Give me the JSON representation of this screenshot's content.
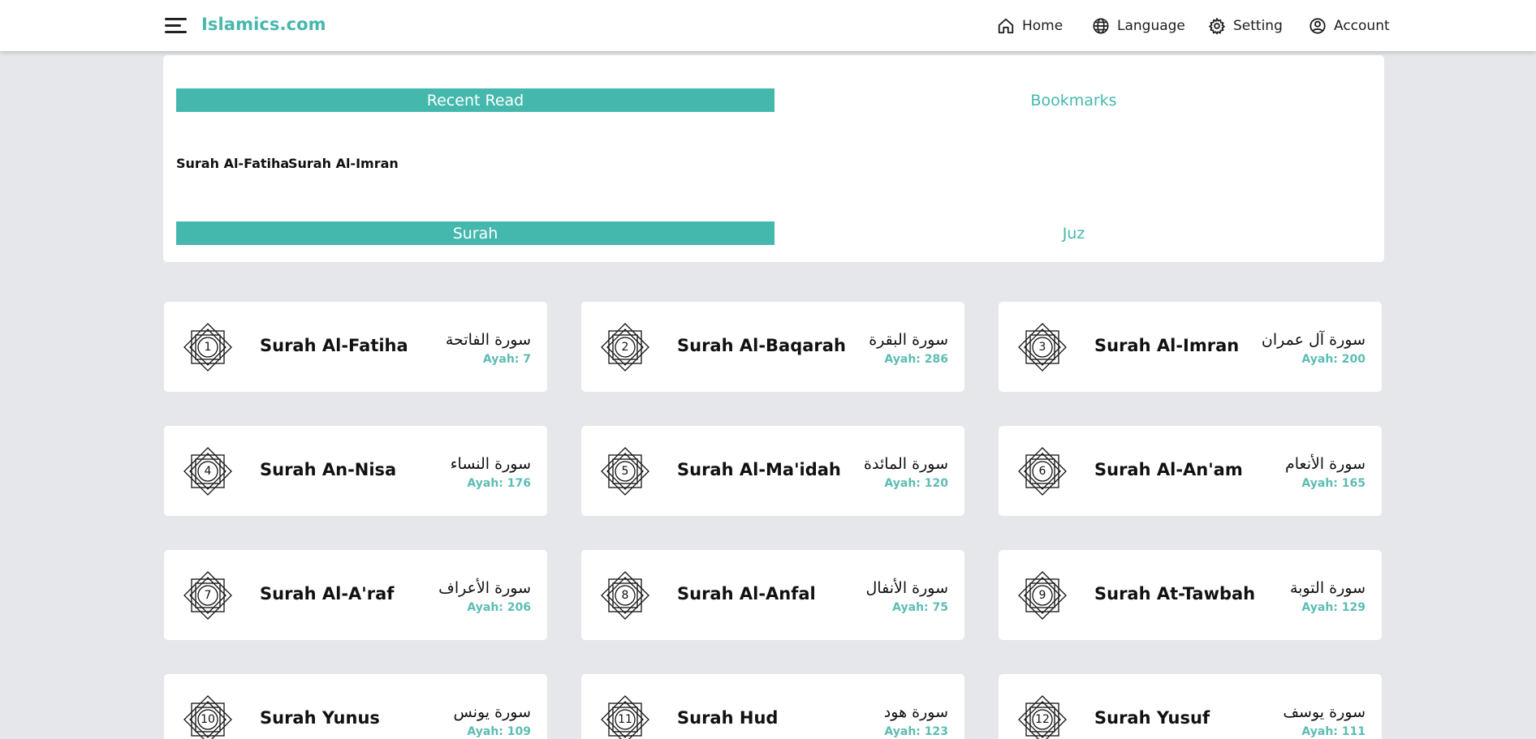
{
  "header": {
    "brand": "Islamics.com",
    "nav": [
      {
        "label": "Home",
        "icon": "home-icon"
      },
      {
        "label": "Language",
        "icon": "globe-icon"
      },
      {
        "label": "Setting",
        "icon": "gear-icon"
      },
      {
        "label": "Account",
        "icon": "user-circle-icon"
      }
    ]
  },
  "colors": {
    "accent": "#45b8ad",
    "ayah": "#5cbdb3",
    "background": "#e5e7ea"
  },
  "tabs_top": {
    "recent": "Recent Read",
    "bookmarks": "Bookmarks"
  },
  "recent_items": [
    "Surah Al-Fatiha",
    "Surah Al-Imran"
  ],
  "tabs_bottom": {
    "surah": "Surah",
    "juz": "Juz"
  },
  "surahs": [
    {
      "number": "1",
      "name": "Surah Al-Fatiha",
      "arabic": "سورة الفاتحة",
      "ayah": "Ayah: 7"
    },
    {
      "number": "2",
      "name": "Surah Al-Baqarah",
      "arabic": "سورة البقرة",
      "ayah": "Ayah: 286"
    },
    {
      "number": "3",
      "name": "Surah Al-Imran",
      "arabic": "سورة آل عمران",
      "ayah": "Ayah: 200"
    },
    {
      "number": "4",
      "name": "Surah An-Nisa",
      "arabic": "سورة النساء",
      "ayah": "Ayah: 176"
    },
    {
      "number": "5",
      "name": "Surah Al-Ma'idah",
      "arabic": "سورة المائدة",
      "ayah": "Ayah: 120"
    },
    {
      "number": "6",
      "name": "Surah Al-An'am",
      "arabic": "سورة الأنعام",
      "ayah": "Ayah: 165"
    },
    {
      "number": "7",
      "name": "Surah Al-A'raf",
      "arabic": "سورة الأعراف",
      "ayah": "Ayah: 206"
    },
    {
      "number": "8",
      "name": "Surah Al-Anfal",
      "arabic": "سورة الأنفال",
      "ayah": "Ayah: 75"
    },
    {
      "number": "9",
      "name": "Surah At-Tawbah",
      "arabic": "سورة التوبة",
      "ayah": "Ayah: 129"
    },
    {
      "number": "10",
      "name": "Surah Yunus",
      "arabic": "سورة يونس",
      "ayah": "Ayah: 109"
    },
    {
      "number": "11",
      "name": "Surah Hud",
      "arabic": "سورة هود",
      "ayah": "Ayah: 123"
    },
    {
      "number": "12",
      "name": "Surah Yusuf",
      "arabic": "سورة يوسف",
      "ayah": "Ayah: 111"
    }
  ]
}
